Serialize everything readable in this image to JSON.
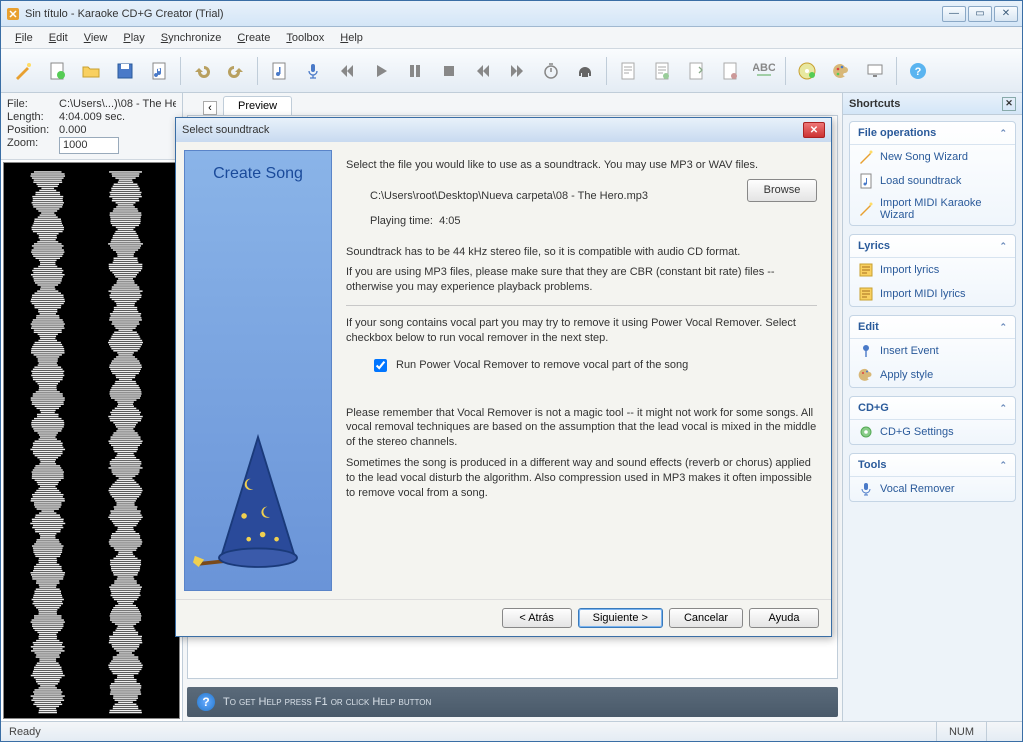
{
  "window": {
    "title": "Sin título - Karaoke CD+G Creator (Trial)"
  },
  "menu": [
    "File",
    "Edit",
    "View",
    "Play",
    "Synchronize",
    "Create",
    "Toolbox",
    "Help"
  ],
  "fileinfo": {
    "file_label": "File:",
    "file_value": "C:\\Users\\...)\\08 - The He",
    "length_label": "Length:",
    "length_value": "4:04.009 sec.",
    "position_label": "Position:",
    "position_value": "0.000",
    "zoom_label": "Zoom:",
    "zoom_value": "1000"
  },
  "tabs": {
    "preview": "Preview"
  },
  "helpbar": "To get Help press F1 or click Help button",
  "rightpanel": {
    "title": "Shortcuts",
    "groups": [
      {
        "title": "File operations",
        "items": [
          "New Song Wizard",
          "Load soundtrack",
          "Import MIDI Karaoke Wizard"
        ]
      },
      {
        "title": "Lyrics",
        "items": [
          "Import lyrics",
          "Import MIDI lyrics"
        ]
      },
      {
        "title": "Edit",
        "items": [
          "Insert Event",
          "Apply style"
        ]
      },
      {
        "title": "CD+G",
        "items": [
          "CD+G Settings"
        ]
      },
      {
        "title": "Tools",
        "items": [
          "Vocal Remover"
        ]
      }
    ]
  },
  "statusbar": {
    "ready": "Ready",
    "num": "NUM"
  },
  "dialog": {
    "title": "Select soundtrack",
    "side_heading": "Create Song",
    "intro": "Select the file you would like to use as a soundtrack. You may use MP3 or WAV files.",
    "filepath": "C:\\Users\\root\\Desktop\\Nueva carpeta\\08 - The Hero.mp3",
    "browse": "Browse",
    "playing_label": "Playing time:",
    "playing_value": "4:05",
    "note1": "Soundtrack has to be 44 kHz stereo file, so it is compatible with audio CD format.",
    "note2": "If you are using MP3 files, please make sure that they are CBR (constant bit rate) files -- otherwise you may experience playback problems.",
    "vocal_intro": "If your song contains vocal part you may try to remove it using Power Vocal Remover. Select checkbox below to run vocal remover in the next step.",
    "checkbox_label": "Run Power Vocal Remover to remove vocal part of the song",
    "disclaimer1": "Please remember that Vocal Remover is not a magic tool -- it might not work for some songs. All vocal removal techniques are based on the assumption that the lead vocal is mixed in the middle of the stereo channels.",
    "disclaimer2": "Sometimes the song is produced in a different way and sound effects (reverb or chorus) applied to the lead vocal disturb the algorithm. Also compression used in MP3 makes it often impossible to remove vocal from a song.",
    "buttons": {
      "back": "< Atrás",
      "next": "Siguiente >",
      "cancel": "Cancelar",
      "help": "Ayuda"
    }
  }
}
